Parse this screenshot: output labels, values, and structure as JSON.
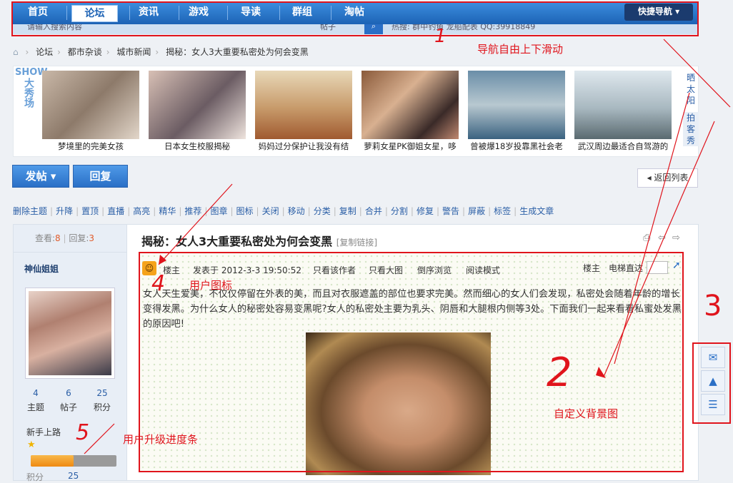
{
  "nav": {
    "items": [
      "首页",
      "论坛",
      "资讯",
      "游戏",
      "导读",
      "群组",
      "淘帖"
    ],
    "active": "论坛",
    "quick_nav": "快捷导航",
    "sub": {
      "search_ph": "请输入搜索内容",
      "type": "帖子",
      "hot": "热搜: 群中钓鱼 龙船配表 QQ:39918849"
    }
  },
  "breadcrumb": [
    "论坛",
    "都市杂谈",
    "城市新闻",
    "揭秘：女人3大重要私密处为何会变黑"
  ],
  "show": {
    "logo": "SHOW",
    "logo_sub": "大秀场",
    "captions": [
      "梦境里的完美女孩",
      "日本女生校服揭秘",
      "妈妈过分保护让我没有结",
      "萝莉女星PK御姐女星，哆",
      "曾被爆18岁投靠黑社会老",
      "武汉周边最适合自驾游的"
    ],
    "tab1": "晒太阳",
    "tab2": "拍客秀"
  },
  "buttons": {
    "post": "发帖",
    "reply": "回复",
    "back": "返回列表"
  },
  "mod": [
    "删除主题",
    "升降",
    "置顶",
    "直播",
    "高亮",
    "精华",
    "推荐",
    "图章",
    "图标",
    "关闭",
    "移动",
    "分类",
    "复制",
    "合并",
    "分割",
    "修复",
    "警告",
    "屏蔽",
    "标签",
    "生成文章"
  ],
  "thread": {
    "views_label": "查看:",
    "views": "8",
    "replies_label": "回复:",
    "replies": "3",
    "title": "揭秘：女人3大重要私密处为何会变黑",
    "copy_link": "[复制链接]"
  },
  "author": {
    "name": "神仙姐姐",
    "stats": [
      {
        "v": "4",
        "l": "主题"
      },
      {
        "v": "6",
        "l": "帖子"
      },
      {
        "v": "25",
        "l": "积分"
      }
    ],
    "rank": "新手上路",
    "progress": 0.5,
    "points_label": "积分",
    "points": "25"
  },
  "post": {
    "owner": "楼主",
    "time": "发表于 2012-3-3 19:50:52",
    "links": [
      "只看该作者",
      "只看大图",
      "倒序浏览",
      "阅读模式"
    ],
    "floor": "楼主",
    "jump": "电梯直达",
    "body": "女人天生爱美，不仅仅停留在外表的美，而且对衣服遮盖的部位也要求完美。然而细心的女人们会发现，私密处会随着年龄的增长变得发黑。为什么女人的秘密处容易变黑呢?女人的私密处主要为乳头、阴唇和大腿根内侧等3处。下面我们一起来看看私蜜处发黑的原因吧!"
  },
  "annotations": {
    "n1": "1",
    "nav": "导航自由上下滑动",
    "n2": "2",
    "bg": "自定义背景图",
    "n3": "3",
    "n4": "4",
    "icon": "用户图标",
    "n5": "5",
    "progress": "用户升级进度条"
  },
  "colors": {
    "nav": "#1d63b5",
    "annotation": "#e0141c",
    "progress": "#f39a1e"
  }
}
